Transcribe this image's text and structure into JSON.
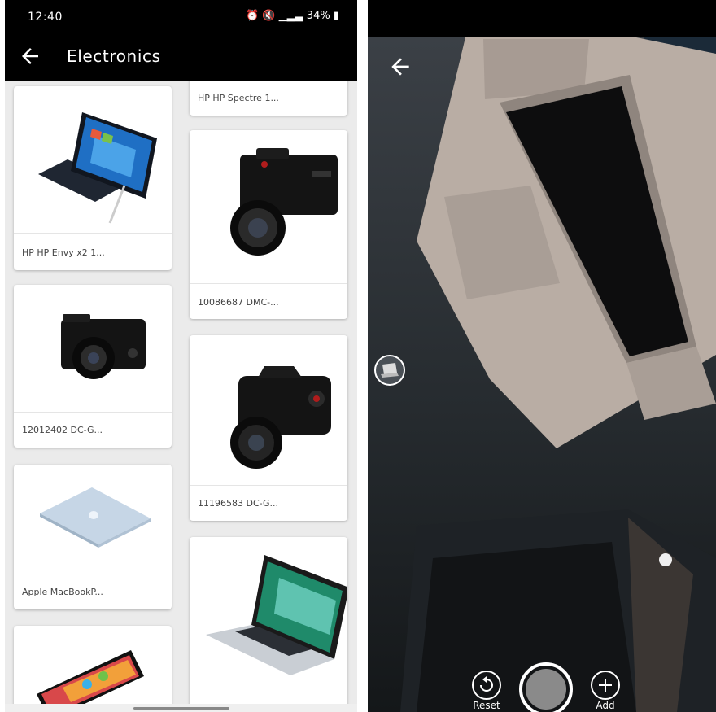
{
  "left_screen": {
    "status_bar": {
      "time": "12:40",
      "battery": "34%"
    },
    "app_bar": {
      "back_icon": "arrow-left-icon",
      "title": "Electronics"
    },
    "products": [
      {
        "label": "HP HP Spectre 1...",
        "image": "laptop-icon"
      },
      {
        "label": "HP HP Envy x2 1...",
        "image": "tablet-laptop-icon"
      },
      {
        "label": "10086687 DMC-...",
        "image": "camera-icon"
      },
      {
        "label": "12012402 DC-G...",
        "image": "camera-icon"
      },
      {
        "label": "11196583 DC-G...",
        "image": "dslr-camera-icon"
      },
      {
        "label": "Apple MacBookP...",
        "image": "macbook-icon"
      },
      {
        "label": "",
        "image": "macbook-pro-icon"
      },
      {
        "label": "",
        "image": "smartphone-icon"
      }
    ]
  },
  "right_screen": {
    "back_icon": "arrow-left-icon",
    "model_thumbnail_icon": "laptop-icon",
    "controls": {
      "reset_label": "Reset",
      "reset_icon": "reset-icon",
      "add_label": "Add",
      "add_icon": "plus-icon",
      "capture_icon": "shutter-icon"
    }
  },
  "colors": {
    "app_bar": "#000000",
    "background": "#ebebeb",
    "card": "#ffffff",
    "ar_laptop": "#b9ada4"
  }
}
